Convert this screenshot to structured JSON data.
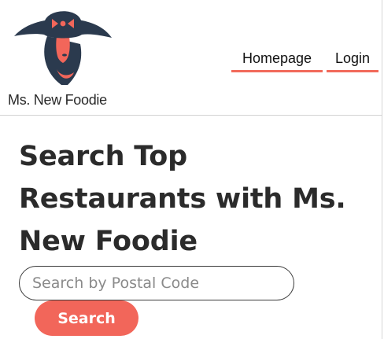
{
  "brand": {
    "name": "Ms. New Foodie",
    "logo_icon": "woman-in-wide-hat-icon"
  },
  "nav": {
    "items": [
      {
        "label": "Homepage"
      },
      {
        "label": "Login"
      }
    ]
  },
  "main": {
    "title": "Search Top Restaurants with Ms. New Foodie",
    "search": {
      "placeholder": "Search by Postal Code",
      "value": "",
      "button_label": "Search"
    }
  },
  "colors": {
    "accent": "#f2665a",
    "navy": "#2b3a4e",
    "text": "#2b2b2b"
  }
}
